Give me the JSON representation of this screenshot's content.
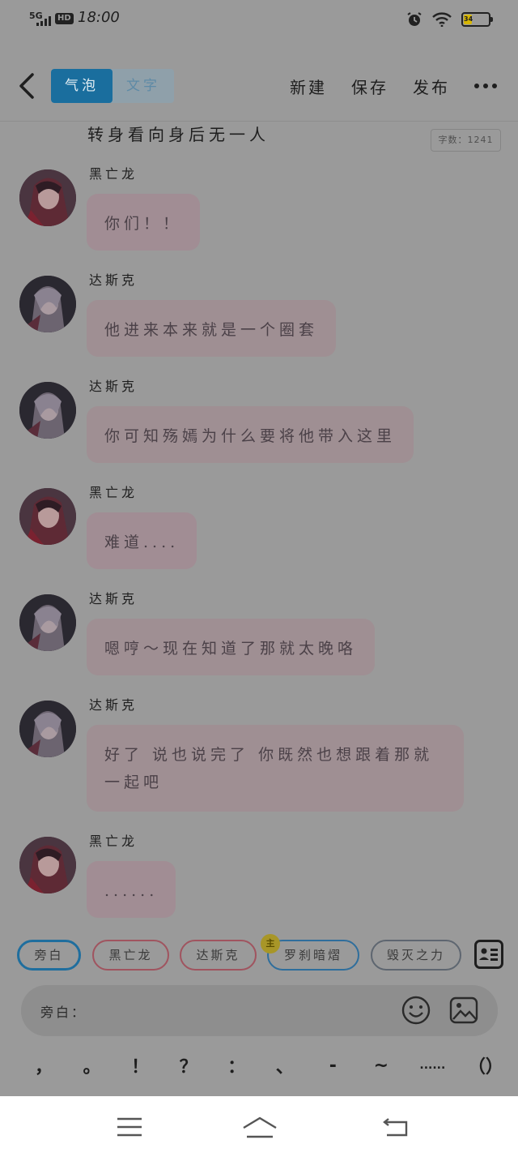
{
  "status_bar": {
    "network": "5G",
    "hd": "HD",
    "time": "18:00",
    "battery": "34"
  },
  "nav": {
    "tabs": [
      {
        "label": "气泡",
        "active": true
      },
      {
        "label": "文字",
        "active": false
      }
    ],
    "actions": {
      "new": "新建",
      "save": "保存",
      "publish": "发布"
    }
  },
  "chat": {
    "previous_text": "转身看向身后无一人",
    "word_count": "字数：1241",
    "messages": [
      {
        "speaker": "黑亡龙",
        "text": "你们！！"
      },
      {
        "speaker": "达斯克",
        "text": "他进来本来就是一个圈套"
      },
      {
        "speaker": "达斯克",
        "text": "你可知殇嫣为什么要将他带入这里"
      },
      {
        "speaker": "黑亡龙",
        "text": "难道...."
      },
      {
        "speaker": "达斯克",
        "text": "嗯哼～现在知道了那就太晚咯"
      },
      {
        "speaker": "达斯克",
        "text": "好了 说也说完了 你既然也想跟着那就一起吧"
      },
      {
        "speaker": "黑亡龙",
        "text": "......"
      }
    ]
  },
  "characters": {
    "chips": [
      "旁白",
      "黑亡龙",
      "达斯克",
      "罗刹暗熠",
      "毁灭之力"
    ],
    "badge": "主"
  },
  "input": {
    "label": "旁白：",
    "value": ""
  },
  "punctuation": [
    "，",
    "。",
    "！",
    "？",
    "：",
    "、",
    "-",
    "~",
    "......",
    "（）"
  ],
  "colors": {
    "accent": "#1a6e9e",
    "bubble_pink": "#a18d94",
    "overlay_background": "#9a9a9a"
  }
}
